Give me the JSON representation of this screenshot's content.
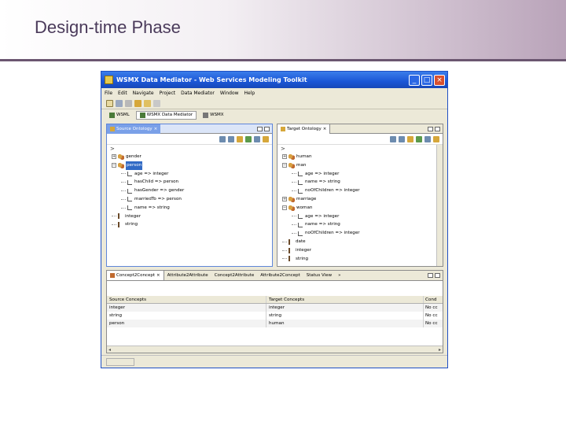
{
  "slide": {
    "title": "Design-time Phase"
  },
  "window": {
    "title": "WSMX Data Mediator - Web Services Modeling Toolkit",
    "controls": {
      "minimize": "_",
      "maximize": "□",
      "close": "×"
    }
  },
  "menu": [
    "File",
    "Edit",
    "Navigate",
    "Project",
    "Data Mediator",
    "Window",
    "Help"
  ],
  "perspectives": [
    "WSML",
    "WSMX Data Mediator",
    "WSMX"
  ],
  "source_view": {
    "tab": "Source Ontology",
    "input": ">",
    "tree": [
      {
        "label": "gender",
        "kind": "concept",
        "level": 0,
        "expanded": false
      },
      {
        "label": "person",
        "kind": "concept",
        "level": 0,
        "expanded": true,
        "selected": true
      },
      {
        "label": "age => integer",
        "kind": "attribute",
        "level": 1
      },
      {
        "label": "hasChild => person",
        "kind": "attribute",
        "level": 1
      },
      {
        "label": "hasGender => gender",
        "kind": "attribute",
        "level": 1
      },
      {
        "label": "marriedTo => person",
        "kind": "attribute",
        "level": 1
      },
      {
        "label": "name => string",
        "kind": "attribute",
        "level": 1
      },
      {
        "label": "integer",
        "kind": "type",
        "level": 0
      },
      {
        "label": "string",
        "kind": "type",
        "level": 0
      }
    ]
  },
  "target_view": {
    "tab": "Target Ontology",
    "input": ">",
    "tree": [
      {
        "label": "human",
        "kind": "concept",
        "level": 0,
        "expanded": false
      },
      {
        "label": "man",
        "kind": "concept",
        "level": 0,
        "expanded": true
      },
      {
        "label": "age => integer",
        "kind": "attribute",
        "level": 1
      },
      {
        "label": "name => string",
        "kind": "attribute",
        "level": 1
      },
      {
        "label": "noOfChildren => integer",
        "kind": "attribute",
        "level": 1
      },
      {
        "label": "marriage",
        "kind": "concept",
        "level": 0,
        "expanded": false
      },
      {
        "label": "woman",
        "kind": "concept",
        "level": 0,
        "expanded": true
      },
      {
        "label": "age => integer",
        "kind": "attribute",
        "level": 1
      },
      {
        "label": "name => string",
        "kind": "attribute",
        "level": 1
      },
      {
        "label": "noOfChildren => integer",
        "kind": "attribute",
        "level": 1
      },
      {
        "label": "date",
        "kind": "type",
        "level": 0
      },
      {
        "label": "integer",
        "kind": "type",
        "level": 0
      },
      {
        "label": "string",
        "kind": "type",
        "level": 0
      }
    ]
  },
  "bottom_view": {
    "tabs": [
      "Concept2Concept",
      "Attribute2Attribute",
      "Concept2Attribute",
      "Attribute2Concept",
      "Status View"
    ],
    "overflow": "»",
    "columns": [
      "Source Concepts",
      "Target Concepts",
      "Cond"
    ],
    "rows": [
      [
        "integer",
        "integer",
        "No cc"
      ],
      [
        "string",
        "string",
        "No cc"
      ],
      [
        "person",
        "human",
        "No cc"
      ]
    ]
  },
  "colors": {
    "title_bar": "#1b56d6",
    "selection": "#316ac5",
    "active_tab": "#7aa0e8",
    "slide_rule": "#6b5670"
  }
}
